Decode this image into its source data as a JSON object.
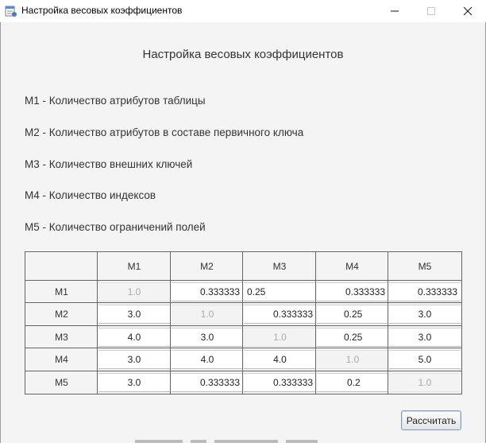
{
  "window": {
    "title": "Настройка весовых коэффициентов",
    "icon": "app-window-icon",
    "controls": [
      "minimize-icon",
      "maximize-icon",
      "close-icon"
    ]
  },
  "heading": "Настройка весовых коэффициентов",
  "legend": [
    "M1 - Количество атрибутов таблицы",
    "M2 - Количество атрибутов в составе первичного ключа",
    "M3 - Количество внешних ключей",
    "M4 - Количество индексов",
    "M5 - Количество ограничений полей"
  ],
  "matrix": {
    "col_headers": [
      "M1",
      "M2",
      "M3",
      "M4",
      "M5"
    ],
    "row_headers": [
      "M1",
      "M2",
      "M3",
      "M4",
      "M5"
    ],
    "rows": [
      [
        "1.0",
        "0.333333",
        "0.25",
        "0.333333",
        "0.333333"
      ],
      [
        "3.0",
        "1.0",
        "0.333333",
        "0.25",
        "3.0"
      ],
      [
        "4.0",
        "3.0",
        "1.0",
        "0.25",
        "3.0"
      ],
      [
        "3.0",
        "4.0",
        "4.0",
        "1.0",
        "5.0"
      ],
      [
        "3.0",
        "0.333333",
        "0.333333",
        "0.2",
        "1.0"
      ]
    ]
  },
  "calculate_button": "Рассчитать",
  "colors": {
    "grid_line": "#666666",
    "background": "#f4f4f4",
    "button_border": "#8a9aae"
  }
}
